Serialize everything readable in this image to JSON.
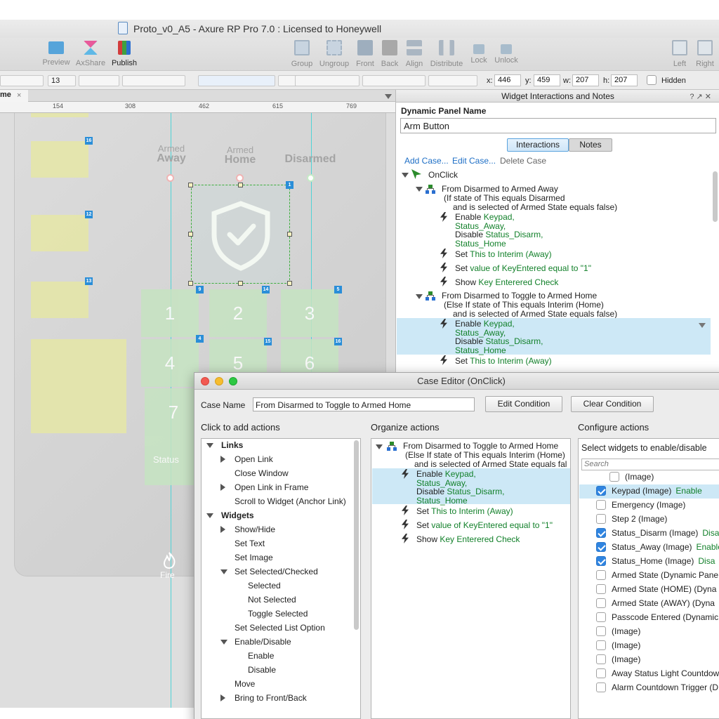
{
  "window": {
    "title": "Proto_v0_A5 - Axure RP Pro 7.0 : Licensed to Honeywell"
  },
  "toolbar": {
    "left": [
      {
        "name": "preview",
        "label": "Preview"
      },
      {
        "name": "axshare",
        "label": "AxShare"
      },
      {
        "name": "publish",
        "label": "Publish"
      }
    ],
    "arrange": [
      {
        "name": "group",
        "label": "Group"
      },
      {
        "name": "ungroup",
        "label": "Ungroup"
      },
      {
        "name": "front",
        "label": "Front"
      },
      {
        "name": "back",
        "label": "Back"
      },
      {
        "name": "align",
        "label": "Align"
      },
      {
        "name": "distribute",
        "label": "Distribute"
      },
      {
        "name": "lock",
        "label": "Lock"
      },
      {
        "name": "unlock",
        "label": "Unlock"
      }
    ],
    "right": [
      {
        "name": "left",
        "label": "Left"
      },
      {
        "name": "right",
        "label": "Right"
      }
    ]
  },
  "format": {
    "font_size": "13",
    "x_label": "x:",
    "x": "446",
    "y_label": "y:",
    "y": "459",
    "w_label": "w:",
    "w": "207",
    "h_label": "h:",
    "h": "207",
    "hidden_label": "Hidden"
  },
  "canvas": {
    "tab": "me",
    "tab_close": "×",
    "ruler": [
      "154",
      "308",
      "462",
      "615",
      "769"
    ],
    "modes": [
      {
        "top": "Armed",
        "bottom": "Away"
      },
      {
        "top": "Armed",
        "bottom": "Home"
      },
      {
        "top": "",
        "bottom": "Disarmed"
      }
    ],
    "badges": [
      "16",
      "12",
      "13",
      "1",
      "9",
      "14",
      "5",
      "4",
      "15",
      "16"
    ],
    "keys": [
      "1",
      "2",
      "3",
      "4",
      "5",
      "6",
      "7"
    ],
    "status_label": "Status",
    "fire_label": "Fire"
  },
  "interactions": {
    "title": "Widget Interactions and Notes",
    "controls": "? ↗ ✕",
    "panel_name_label": "Dynamic Panel Name",
    "panel_name": "Arm Button",
    "tabs": [
      "Interactions",
      "Notes"
    ],
    "links": [
      "Add Case...",
      "Edit Case...",
      "Delete Case"
    ],
    "event": "OnClick",
    "case1": {
      "title": "From Disarmed to Armed Away",
      "cond1": "(If state of This equals Disarmed",
      "cond2": "and is selected of Armed State equals false)"
    },
    "case1_actions": [
      {
        "verb": "Enable",
        "targets": [
          "Keypad,",
          "Status_Away,"
        ],
        "verb2": "Disable",
        "targets2": [
          "Status_Disarm,",
          "Status_Home"
        ]
      },
      {
        "verb": "Set",
        "detail": "This to Interim (Away)"
      },
      {
        "verb": "Set",
        "detail": "value of KeyEntered equal to \"1\""
      },
      {
        "verb": "Show",
        "detail": "Key Enterered Check"
      }
    ],
    "case2": {
      "title": "From Disarmed to Toggle to Armed Home",
      "cond1": "(Else If state of This equals Interim (Home)",
      "cond2": "and is selected of Armed State equals false)"
    },
    "case2_actions": [
      {
        "verb": "Enable",
        "targets": [
          "Keypad,",
          "Status_Away,"
        ],
        "verb2": "Disable",
        "targets2": [
          "Status_Disarm,",
          "Status_Home"
        ]
      },
      {
        "verb": "Set",
        "detail": "This to Interim (Away)"
      }
    ]
  },
  "case_editor": {
    "title": "Case Editor (OnClick)",
    "case_name_label": "Case Name",
    "case_name": "From Disarmed to Toggle to Armed Home",
    "edit_condition": "Edit Condition",
    "clear_condition": "Clear Condition",
    "col1": "Click to add actions",
    "col2": "Organize actions",
    "col3": "Configure actions",
    "actions_tree": [
      {
        "t": "Links",
        "lvl": 0,
        "bold": true,
        "exp": "down"
      },
      {
        "t": "Open Link",
        "lvl": 1,
        "exp": "right"
      },
      {
        "t": "Close Window",
        "lvl": 1,
        "exp": ""
      },
      {
        "t": "Open Link in Frame",
        "lvl": 1,
        "exp": "right"
      },
      {
        "t": "Scroll to Widget (Anchor Link)",
        "lvl": 1,
        "exp": ""
      },
      {
        "t": "Widgets",
        "lvl": 0,
        "bold": true,
        "exp": "down"
      },
      {
        "t": "Show/Hide",
        "lvl": 1,
        "exp": "right"
      },
      {
        "t": "Set Text",
        "lvl": 1,
        "exp": ""
      },
      {
        "t": "Set Image",
        "lvl": 1,
        "exp": ""
      },
      {
        "t": "Set Selected/Checked",
        "lvl": 1,
        "exp": "down"
      },
      {
        "t": "Selected",
        "lvl": 2,
        "exp": ""
      },
      {
        "t": "Not Selected",
        "lvl": 2,
        "exp": ""
      },
      {
        "t": "Toggle Selected",
        "lvl": 2,
        "exp": ""
      },
      {
        "t": "Set Selected List Option",
        "lvl": 1,
        "exp": ""
      },
      {
        "t": "Enable/Disable",
        "lvl": 1,
        "exp": "down"
      },
      {
        "t": "Enable",
        "lvl": 2,
        "exp": ""
      },
      {
        "t": "Disable",
        "lvl": 2,
        "exp": ""
      },
      {
        "t": "Move",
        "lvl": 1,
        "exp": ""
      },
      {
        "t": "Bring to Front/Back",
        "lvl": 1,
        "exp": "right"
      }
    ],
    "organize": {
      "title": "From Disarmed to Toggle to Armed Home",
      "cond1": "(Else If state of This equals Interim (Home)",
      "cond2": "and is selected of Armed State equals fal",
      "a1": {
        "verb": "Enable",
        "t1": "Keypad,",
        "t2": "Status_Away,",
        "verb2": "Disable",
        "t3": "Status_Disarm,",
        "t4": "Status_Home"
      },
      "a2": {
        "verb": "Set",
        "detail": "This to Interim (Away)"
      },
      "a3": {
        "verb": "Set",
        "detail": "value of KeyEntered equal to \"1\""
      },
      "a4": {
        "verb": "Show",
        "detail": "Key Enterered Check"
      }
    },
    "configure": {
      "label": "Select widgets to enable/disable",
      "search_placeholder": "Search",
      "items": [
        {
          "t": "(Image)",
          "on": false,
          "s": ""
        },
        {
          "t": "Keypad (Image)",
          "on": true,
          "s": "Enable"
        },
        {
          "t": "Emergency (Image)",
          "on": false,
          "s": ""
        },
        {
          "t": "Step 2 (Image)",
          "on": false,
          "s": ""
        },
        {
          "t": "Status_Disarm (Image)",
          "on": true,
          "s": "Disa"
        },
        {
          "t": "Status_Away (Image)",
          "on": true,
          "s": "Enable"
        },
        {
          "t": "Status_Home (Image)",
          "on": true,
          "s": "Disa"
        },
        {
          "t": "Armed State (Dynamic Pane",
          "on": false,
          "s": ""
        },
        {
          "t": "Armed State (HOME) (Dyna",
          "on": false,
          "s": ""
        },
        {
          "t": "Armed State (AWAY) (Dyna",
          "on": false,
          "s": ""
        },
        {
          "t": "Passcode Entered (Dynamic",
          "on": false,
          "s": ""
        },
        {
          "t": "(Image)",
          "on": false,
          "s": ""
        },
        {
          "t": "(Image)",
          "on": false,
          "s": ""
        },
        {
          "t": "(Image)",
          "on": false,
          "s": ""
        },
        {
          "t": "Away Status Light Countdow",
          "on": false,
          "s": ""
        },
        {
          "t": "Alarm Countdown Trigger (D",
          "on": false,
          "s": ""
        }
      ]
    },
    "colors": {
      "green": "#12802a",
      "selection": "#cde8f6",
      "accent": "#2f84e0"
    }
  }
}
